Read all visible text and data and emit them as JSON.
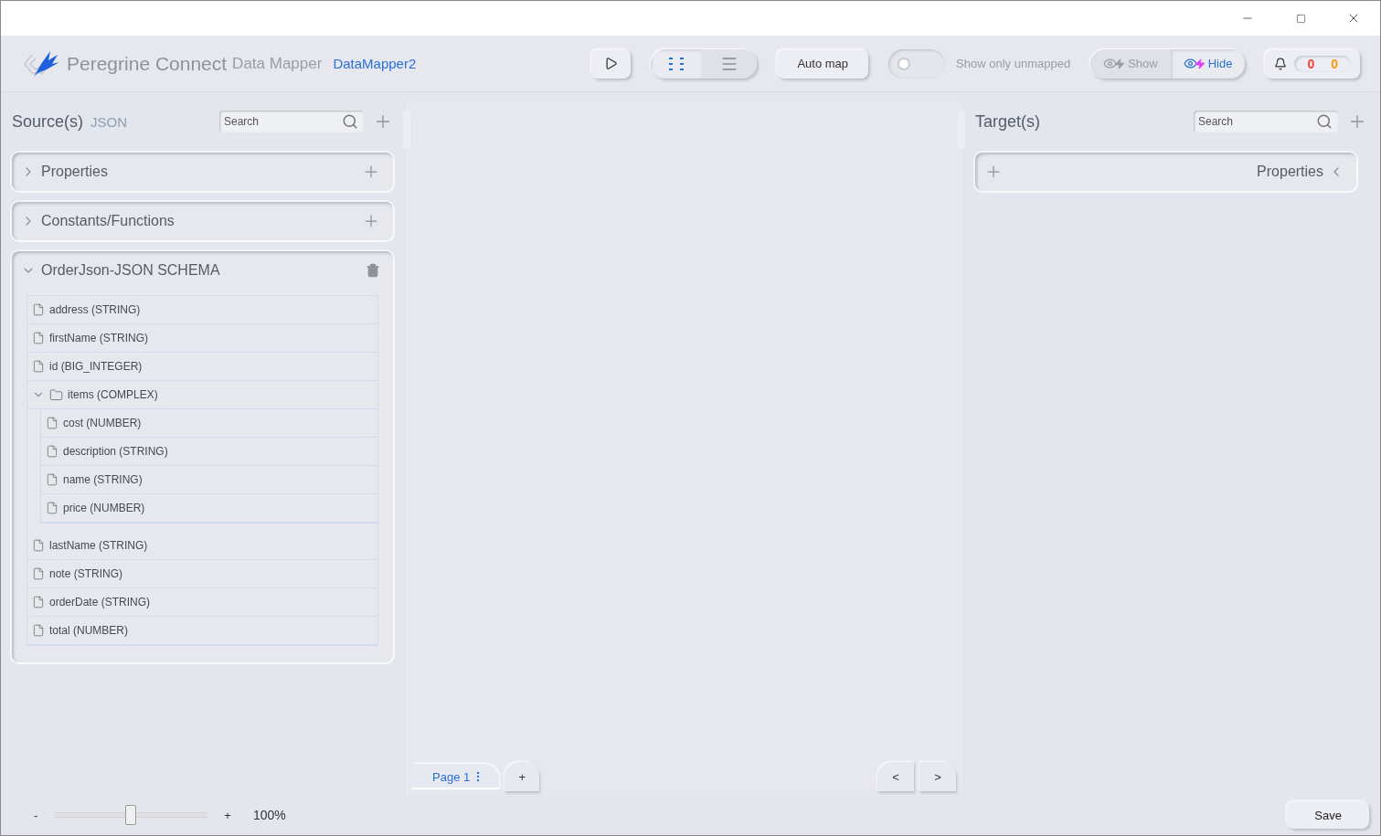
{
  "app": {
    "brand": "Peregrine Connect",
    "product": "Data Mapper",
    "name": "DataMapper2"
  },
  "toolbar": {
    "view_modes": [
      {
        "kind": "mapping",
        "selected": true
      },
      {
        "kind": "list",
        "selected": false
      }
    ],
    "auto_map": "Auto map",
    "unmapped_toggle": {
      "on": false,
      "label": "Show only unmapped"
    },
    "visibility": [
      {
        "label": "Show",
        "selected": false
      },
      {
        "label": "Hide",
        "selected": true
      }
    ],
    "counts": [
      {
        "value": "0",
        "color": "#ff3b30"
      },
      {
        "value": "0",
        "color": "#ff9800"
      }
    ]
  },
  "source": {
    "title": "Source(s)",
    "format": "JSON",
    "search": {
      "placeholder": "Search"
    },
    "sections": [
      {
        "title": "Properties",
        "kind": "group",
        "expanded": false
      },
      {
        "title": "Constants/Functions",
        "kind": "group",
        "expanded": false
      },
      {
        "title": "OrderJson-JSON SCHEMA",
        "kind": "schema",
        "expanded": true,
        "fields": [
          {
            "label": "address (STRING)",
            "kind": "leaf"
          },
          {
            "label": "firstName (STRING)",
            "kind": "leaf"
          },
          {
            "label": "id (BIG_INTEGER)",
            "kind": "leaf"
          },
          {
            "label": "items (COMPLEX)",
            "kind": "complex",
            "expanded": true,
            "children": [
              {
                "label": "cost (NUMBER)",
                "kind": "leaf"
              },
              {
                "label": "description (STRING)",
                "kind": "leaf"
              },
              {
                "label": "name (STRING)",
                "kind": "leaf"
              },
              {
                "label": "price (NUMBER)",
                "kind": "leaf"
              }
            ]
          },
          {
            "label": "lastName (STRING)",
            "kind": "leaf"
          },
          {
            "label": "note (STRING)",
            "kind": "leaf"
          },
          {
            "label": "orderDate (STRING)",
            "kind": "leaf"
          },
          {
            "label": "total (NUMBER)",
            "kind": "leaf"
          }
        ]
      }
    ]
  },
  "target": {
    "title": "Target(s)",
    "search": {
      "placeholder": "Search"
    },
    "sections": [
      {
        "title": "Properties",
        "kind": "group",
        "expanded": false
      }
    ]
  },
  "pages": [
    {
      "label": "Page 1",
      "selected": true
    }
  ],
  "add_page": "+",
  "nav": [
    "<",
    ">"
  ],
  "zoom": {
    "minus": "-",
    "plus": "+",
    "level": 0.5,
    "reading": "100%"
  },
  "save": "Save"
}
